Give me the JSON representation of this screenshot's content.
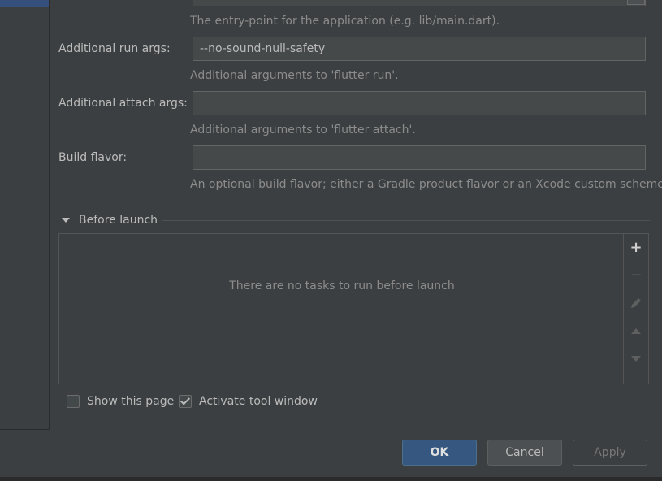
{
  "form": {
    "entrypoint_hint": "The entry-point for the application (e.g. lib/main.dart).",
    "run_args_label": "Additional run args:",
    "run_args_value": "--no-sound-null-safety",
    "run_args_hint": "Additional arguments to 'flutter run'.",
    "attach_args_label": "Additional attach args:",
    "attach_args_value": "",
    "attach_args_hint": "Additional arguments to 'flutter attach'.",
    "build_flavor_label": "Build flavor:",
    "build_flavor_value": "",
    "build_flavor_hint": "An optional build flavor; either a Gradle product flavor or an Xcode custom scheme."
  },
  "before_launch": {
    "title": "Before launch",
    "empty_text": "There are no tasks to run before launch",
    "toolbar": [
      "add-icon",
      "remove-icon",
      "edit-icon",
      "move-up-icon",
      "move-down-icon"
    ]
  },
  "options": {
    "show_this_page_label": "Show this page",
    "show_this_page_checked": false,
    "activate_tool_window_label": "Activate tool window",
    "activate_tool_window_checked": true
  },
  "buttons": {
    "ok": "OK",
    "cancel": "Cancel",
    "apply": "Apply"
  },
  "colors": {
    "background": "#3c3f41",
    "field_background": "#45494a",
    "primary_button": "#365880",
    "hint_text": "#8c8c8c"
  }
}
